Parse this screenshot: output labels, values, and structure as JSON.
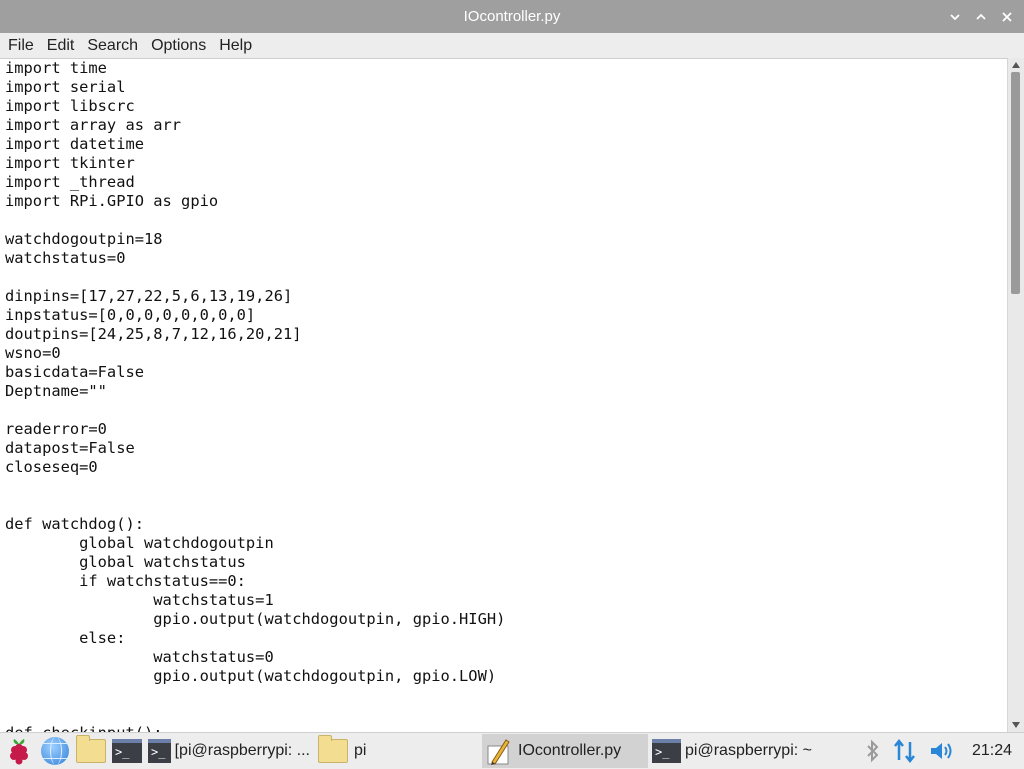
{
  "window": {
    "title": "IOcontroller.py",
    "buttons": [
      "minimize",
      "maximize",
      "close"
    ]
  },
  "menu": [
    "File",
    "Edit",
    "Search",
    "Options",
    "Help"
  ],
  "editor": {
    "lines": [
      "import time",
      "import serial",
      "import libscrc",
      "import array as arr",
      "import datetime",
      "import tkinter",
      "import _thread",
      "import RPi.GPIO as gpio",
      "",
      "watchdogoutpin=18",
      "watchstatus=0",
      "",
      "dinpins=[17,27,22,5,6,13,19,26]",
      "inpstatus=[0,0,0,0,0,0,0,0]",
      "doutpins=[24,25,8,7,12,16,20,21]",
      "wsno=0",
      "basicdata=False",
      "Deptname=\"\"",
      "",
      "readerror=0",
      "datapost=False",
      "closeseq=0",
      "",
      "",
      "def watchdog():",
      "        global watchdogoutpin",
      "        global watchstatus",
      "        if watchstatus==0:",
      "                watchstatus=1",
      "                gpio.output(watchdogoutpin, gpio.HIGH)",
      "        else:",
      "                watchstatus=0",
      "                gpio.output(watchdogoutpin, gpio.LOW)",
      "",
      "",
      "def checkinput():"
    ]
  },
  "taskbar": {
    "tasks": [
      {
        "label": "[pi@raspberrypi: ...",
        "icon": "terminal-icon",
        "active": false
      },
      {
        "label": "pi",
        "icon": "folder-icon",
        "active": false
      },
      {
        "label": "IOcontroller.py",
        "icon": "text-editor-icon",
        "active": true
      },
      {
        "label": "pi@raspberrypi: ~",
        "icon": "terminal-icon",
        "active": false
      }
    ],
    "clock": "21:24"
  },
  "colors": {
    "titlebar": "#9f9f9f",
    "menubar": "#ededed",
    "taskbar": "#ededed",
    "active_task": "#d2d2d2"
  }
}
